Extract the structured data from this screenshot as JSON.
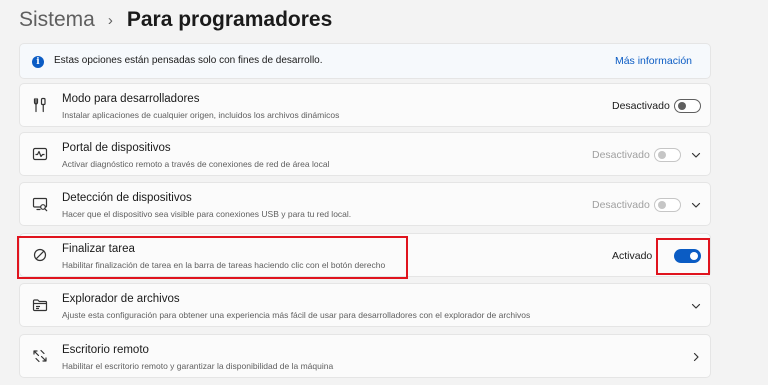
{
  "breadcrumb": {
    "parent": "Sistema",
    "separator": "›",
    "current": "Para programadores"
  },
  "info": {
    "text": "Estas opciones están pensadas solo con fines de desarrollo.",
    "link": "Más información",
    "icon": "i"
  },
  "rows": [
    {
      "title": "Modo para desarrolladores",
      "description": "Instalar aplicaciones de cualquier origen, incluidos los archivos dinámicos",
      "state": "Desactivado",
      "toggle": "off",
      "icon": "tools-icon"
    },
    {
      "title": "Portal de dispositivos",
      "description": "Activar diagnóstico remoto a través de conexiones de red de área local",
      "state": "Desactivado",
      "toggle": "disabled",
      "icon": "pulse-icon"
    },
    {
      "title": "Detección de dispositivos",
      "description": "Hacer que el dispositivo sea visible para conexiones USB y para tu red local.",
      "state": "Desactivado",
      "toggle": "disabled",
      "icon": "device-search-icon"
    },
    {
      "title": "Finalizar tarea",
      "description": "Habilitar finalización de tarea en la barra de tareas haciendo clic con el botón derecho",
      "state": "Activado",
      "toggle": "on",
      "icon": "prohibited-icon"
    },
    {
      "title": "Explorador de archivos",
      "description": "Ajuste esta configuración para obtener una experiencia más fácil de usar para desarrolladores con el explorador de archivos",
      "icon": "folder-icon"
    },
    {
      "title": "Escritorio remoto",
      "description": "Habilitar el escritorio remoto y garantizar la disponibilidad de la máquina",
      "icon": "remote-desktop-icon"
    }
  ],
  "colors": {
    "accent": "#0b5cc4",
    "highlight": "#e0141e",
    "background": "#f3f3f3",
    "card": "#fbfbfb"
  }
}
